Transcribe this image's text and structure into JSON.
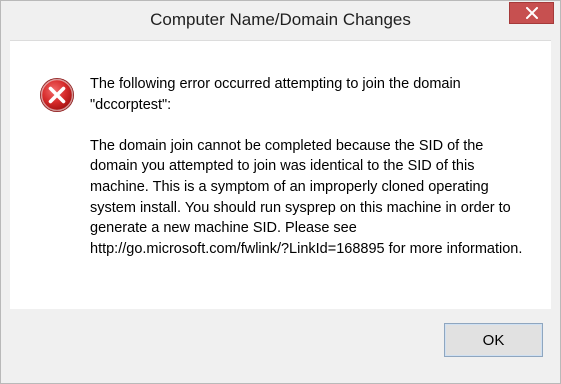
{
  "window": {
    "title": "Computer Name/Domain Changes"
  },
  "titlebar": {
    "close_icon": "close-icon"
  },
  "dialog": {
    "icon": "error-icon",
    "intro": "The following error occurred attempting to join the domain \"dccorptest\":",
    "body": "The domain join cannot be completed because the SID of the domain you attempted to join was identical to the SID of this machine. This is a symptom of an improperly cloned operating system install.  You should run sysprep on this machine in order to generate a new machine SID. Please see http://go.microsoft.com/fwlink/?LinkId=168895 for more information."
  },
  "buttons": {
    "ok_label": "OK"
  },
  "colors": {
    "close_button": "#c75050",
    "error_red": "#d62b2b",
    "dialog_bg": "#ffffff",
    "chrome_bg": "#f0f0f0"
  }
}
